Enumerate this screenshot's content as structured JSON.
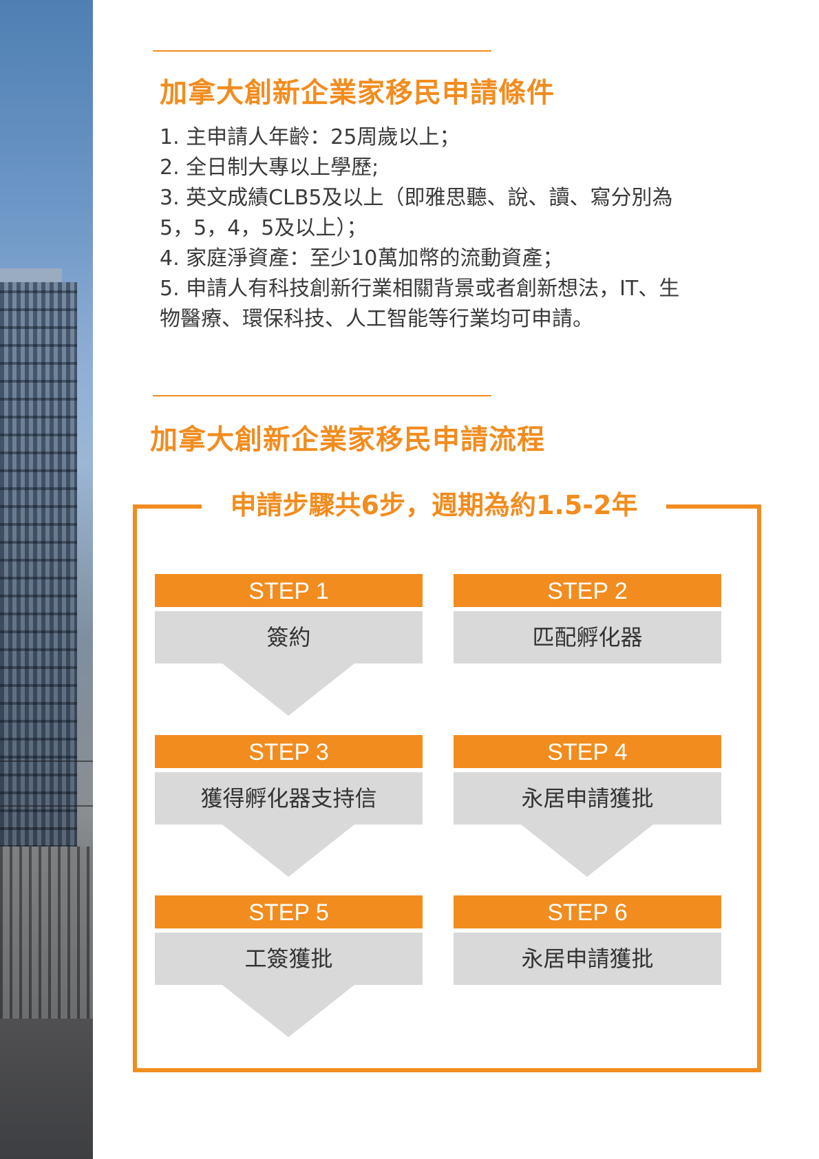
{
  "conditions_section": {
    "title": "加拿大創新企業家移民申請條件",
    "items": [
      "1. 主申請人年齡：25周歲以上；",
      "2. 全日制大專以上學歷;",
      "3. 英文成績CLB5及以上（即雅思聽、說、讀、寫分別為",
      "5，5，4，5及以上）；",
      "4. 家庭淨資產：至少10萬加幣的流動資產；",
      "5.  申請人有科技創新行業相關背景或者創新想法，IT、生",
      "物醫療、環保科技、人工智能等行業均可申請。"
    ]
  },
  "process_section": {
    "title": "加拿大創新企業家移民申請流程",
    "caption": "申請步驟共6步，週期為約1.5-2年",
    "steps": [
      {
        "label": "STEP 1",
        "text": "簽約"
      },
      {
        "label": "STEP 2",
        "text": "匹配孵化器"
      },
      {
        "label": "STEP 3",
        "text": "獲得孵化器支持信"
      },
      {
        "label": "STEP 4",
        "text": "永居申請獲批"
      },
      {
        "label": "STEP 5",
        "text": "工簽獲批"
      },
      {
        "label": "STEP 6",
        "text": "永居申請獲批"
      }
    ]
  },
  "colors": {
    "accent": "#f28c1e",
    "panel": "#d9d9d9",
    "text": "#333333"
  }
}
